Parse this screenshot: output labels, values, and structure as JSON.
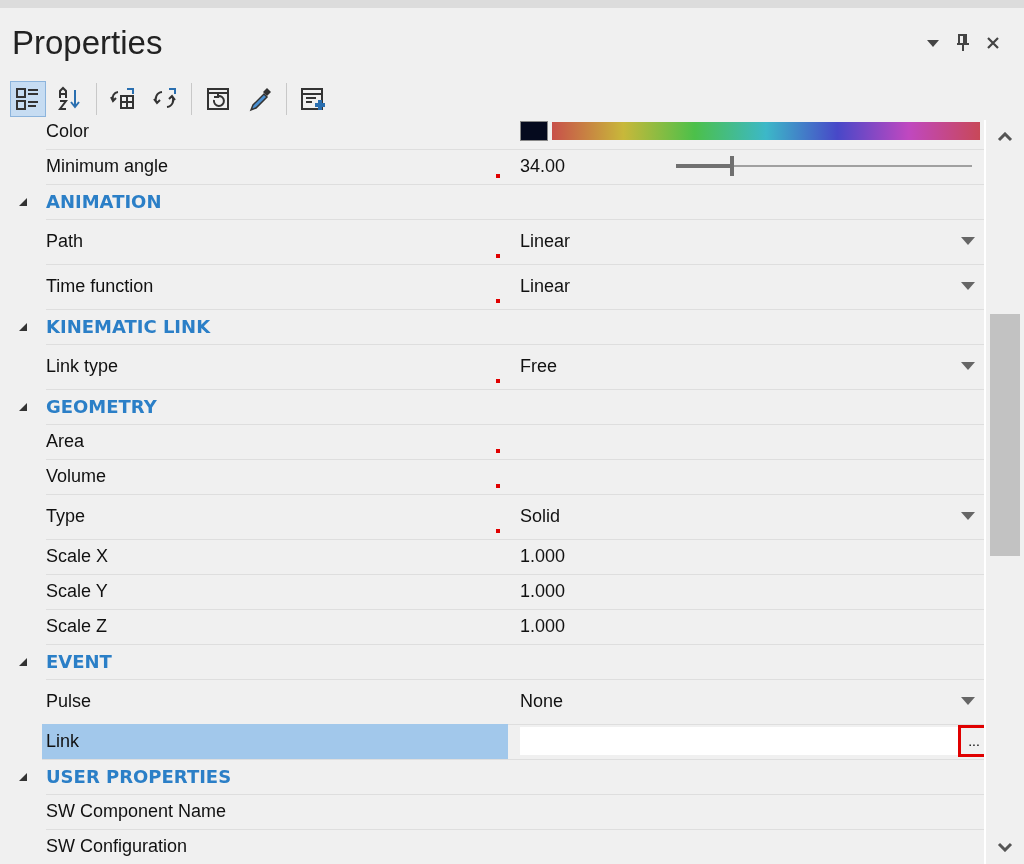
{
  "panel": {
    "title": "Properties",
    "header_buttons": [
      {
        "kind": "dropdown"
      },
      {
        "kind": "pin"
      },
      {
        "kind": "close"
      }
    ]
  },
  "toolbar": [
    {
      "kind": "categorized",
      "selected": true
    },
    {
      "kind": "alphabetical",
      "selected": false
    },
    {
      "kind": "sep"
    },
    {
      "kind": "import",
      "selected": false
    },
    {
      "kind": "sync",
      "selected": false
    },
    {
      "kind": "sep"
    },
    {
      "kind": "reset",
      "selected": false
    },
    {
      "kind": "picker",
      "selected": false
    },
    {
      "kind": "sep"
    },
    {
      "kind": "add",
      "selected": false
    }
  ],
  "grid": [
    {
      "kind": "color",
      "label": "Color",
      "modified": false
    },
    {
      "kind": "slider",
      "label": "Minimum angle",
      "modified": true,
      "value": "34.00",
      "level": 0.19
    },
    {
      "kind": "category",
      "label": "ANIMATION",
      "expanded": true
    },
    {
      "kind": "dropdown",
      "label": "Path",
      "modified": true,
      "value": "Linear"
    },
    {
      "kind": "dropdown",
      "label": "Time function",
      "modified": true,
      "value": "Linear"
    },
    {
      "kind": "category",
      "label": "KINEMATIC LINK",
      "expanded": true
    },
    {
      "kind": "dropdown",
      "label": "Link type",
      "modified": true,
      "value": "Free"
    },
    {
      "kind": "category",
      "label": "GEOMETRY",
      "expanded": true
    },
    {
      "kind": "text",
      "label": "Area",
      "modified": true
    },
    {
      "kind": "text",
      "label": "Volume",
      "modified": true
    },
    {
      "kind": "dropdown",
      "label": "Type",
      "modified": true,
      "value": "Solid"
    },
    {
      "kind": "text",
      "label": "Scale X",
      "modified": false,
      "value": "1.000"
    },
    {
      "kind": "text",
      "label": "Scale Y",
      "modified": false,
      "value": "1.000"
    },
    {
      "kind": "text",
      "label": "Scale Z",
      "modified": false,
      "value": "1.000"
    },
    {
      "kind": "category",
      "label": "EVENT",
      "expanded": true
    },
    {
      "kind": "dropdown",
      "label": "Pulse",
      "modified": false,
      "value": "None"
    },
    {
      "kind": "input",
      "label": "Link",
      "modified": false,
      "selected": true,
      "button": "...",
      "highlighted": true
    },
    {
      "kind": "category",
      "label": "USER PROPERTIES",
      "expanded": true
    },
    {
      "kind": "text",
      "label": "SW Component Name",
      "modified": false
    },
    {
      "kind": "text",
      "label": "SW Configuration",
      "modified": false
    }
  ]
}
